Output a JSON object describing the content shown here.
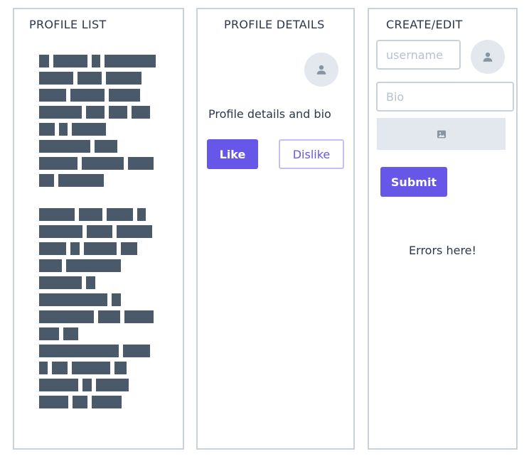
{
  "profile_list": {
    "title": "PROFILE LIST"
  },
  "profile_details": {
    "title": "PROFILE DETAILS",
    "text": "Profile details and bio",
    "like_label": "Like",
    "dislike_label": "Dislike"
  },
  "create_edit": {
    "title": "CREATE/EDIT",
    "username_placeholder": "username",
    "bio_placeholder": "Bio",
    "submit_label": "Submit",
    "errors_text": "Errors here!"
  },
  "icons": {
    "avatar": "user-icon",
    "upload": "image-icon"
  },
  "colors": {
    "accent": "#6657e8",
    "skeleton": "#4a5a6a",
    "panel_border": "#c9d1d9",
    "muted_bg": "#e2e8ee"
  }
}
